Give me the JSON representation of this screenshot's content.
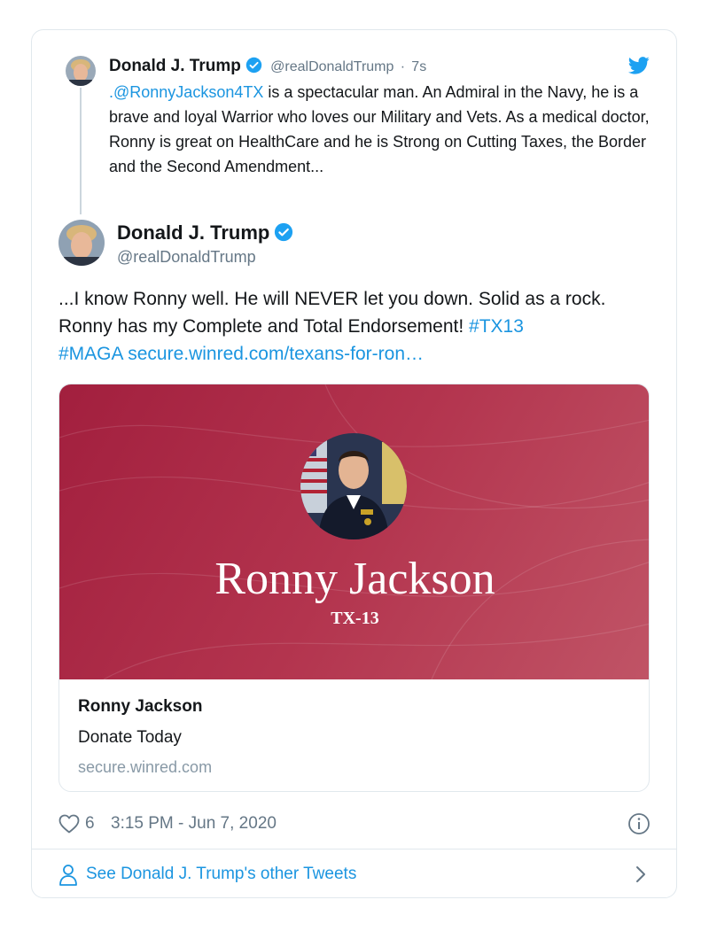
{
  "thread_tweet": {
    "name": "Donald J. Trump",
    "handle": "@realDonaldTrump",
    "separator": "·",
    "time": "7s",
    "mention": ".@RonnyJackson4TX",
    "text": " is a spectacular man. An Admiral in the Navy, he is a brave and loyal Warrior who loves our Military and Vets. As a medical doctor, Ronny is great on HealthCare and he is Strong on Cutting Taxes, the Border and the Second Amendment..."
  },
  "main_tweet": {
    "name": "Donald J. Trump",
    "handle": "@realDonaldTrump",
    "text": "...I know Ronny well. He will NEVER let you down. Solid as a rock. Ronny has my Complete and Total Endorsement! ",
    "hashtag_1": "#TX13",
    "hashtag_2": "#MAGA",
    "url": "secure.winred.com/texans-for-ron…"
  },
  "link_card": {
    "image_title": "Ronny Jackson",
    "image_subtitle": "TX-13",
    "title": "Ronny Jackson",
    "description": "Donate Today",
    "domain": "secure.winred.com"
  },
  "footer": {
    "likes": "6",
    "timestamp": "3:15 PM - Jun 7, 2020"
  },
  "see_more": {
    "label": "See Donald J. Trump's other Tweets"
  },
  "icons": {
    "verified": "verified-badge-icon",
    "twitter": "twitter-bird-icon",
    "heart": "heart-icon",
    "info": "info-icon",
    "person": "person-icon",
    "chevron": "chevron-right-icon"
  },
  "colors": {
    "link": "#1b95e0",
    "verified": "#1da1f2",
    "muted": "#657786",
    "card_bg": "#a21f3e"
  }
}
